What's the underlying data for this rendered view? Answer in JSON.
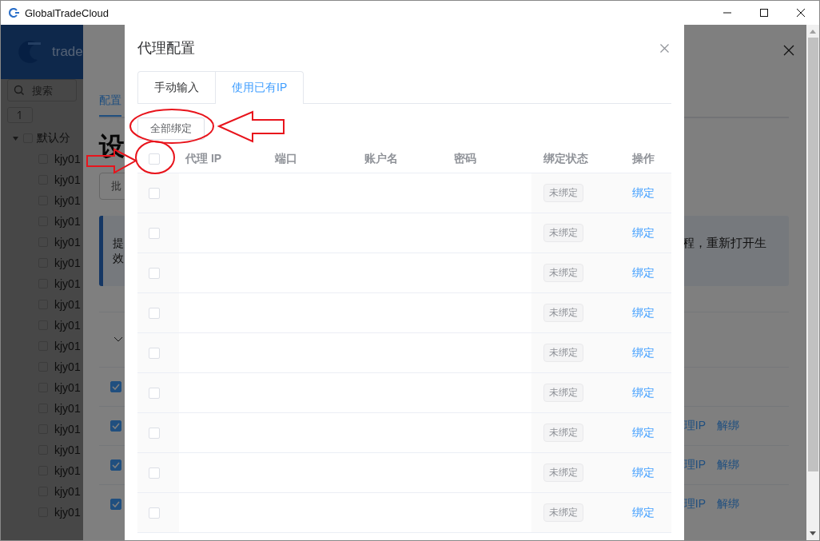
{
  "window": {
    "title": "GlobalTradeCloud"
  },
  "sidebar": {
    "logo_text": "trade",
    "search": {
      "placeholder": "搜索"
    },
    "tree": [
      {
        "label": "默认分",
        "expanded": true,
        "checked": false,
        "children": [
          {
            "label": "kjy01",
            "checked": false
          },
          {
            "label": "kjy01",
            "checked": false
          },
          {
            "label": "kjy01",
            "checked": false
          },
          {
            "label": "kjy01",
            "checked": false
          },
          {
            "label": "kjy01",
            "checked": false
          },
          {
            "label": "kjy01",
            "checked": false
          },
          {
            "label": "kjy01",
            "checked": false
          },
          {
            "label": "kjy01",
            "checked": false
          },
          {
            "label": "kjy01",
            "checked": false
          },
          {
            "label": "kjy01",
            "checked": false
          },
          {
            "label": "kjy01",
            "checked": false
          },
          {
            "label": "kjy01",
            "checked": false
          },
          {
            "label": "kjy01",
            "checked": false
          },
          {
            "label": "kjy01",
            "checked": false
          },
          {
            "label": "kjy01",
            "checked": false
          },
          {
            "label": "kjy01",
            "checked": false
          },
          {
            "label": "kjy01",
            "checked": false
          },
          {
            "label": "kjy01",
            "checked": false
          }
        ]
      }
    ]
  },
  "drawer": {
    "tab": "配置",
    "heading": "设",
    "button": "批",
    "notice": {
      "left_lines": [
        "提",
        "效"
      ],
      "right": "程，重新打开生"
    },
    "rows": [
      {
        "checked": true,
        "links": []
      },
      {
        "checked": true,
        "links": [
          "理IP",
          "解绑"
        ]
      },
      {
        "checked": true,
        "links": [
          "理IP",
          "解绑"
        ]
      },
      {
        "checked": true,
        "links": [
          "理IP",
          "解绑"
        ]
      }
    ]
  },
  "dialog": {
    "title": "代理配置",
    "tabs": [
      {
        "label": "手动输入",
        "selected": false
      },
      {
        "label": "使用已有IP",
        "selected": true
      }
    ],
    "bind_all_button": "全部绑定",
    "table": {
      "select_all": {
        "checked": false
      },
      "columns": [
        "代理 IP",
        "端口",
        "账户名",
        "密码",
        "绑定状态",
        "操作"
      ],
      "rows": [
        {
          "checked": false,
          "status": "未绑定",
          "action": "绑定"
        },
        {
          "checked": false,
          "status": "未绑定",
          "action": "绑定"
        },
        {
          "checked": false,
          "status": "未绑定",
          "action": "绑定"
        },
        {
          "checked": false,
          "status": "未绑定",
          "action": "绑定"
        },
        {
          "checked": false,
          "status": "未绑定",
          "action": "绑定"
        },
        {
          "checked": false,
          "status": "未绑定",
          "action": "绑定"
        },
        {
          "checked": false,
          "status": "未绑定",
          "action": "绑定"
        },
        {
          "checked": false,
          "status": "未绑定",
          "action": "绑定"
        },
        {
          "checked": false,
          "status": "未绑定",
          "action": "绑定"
        }
      ]
    }
  }
}
